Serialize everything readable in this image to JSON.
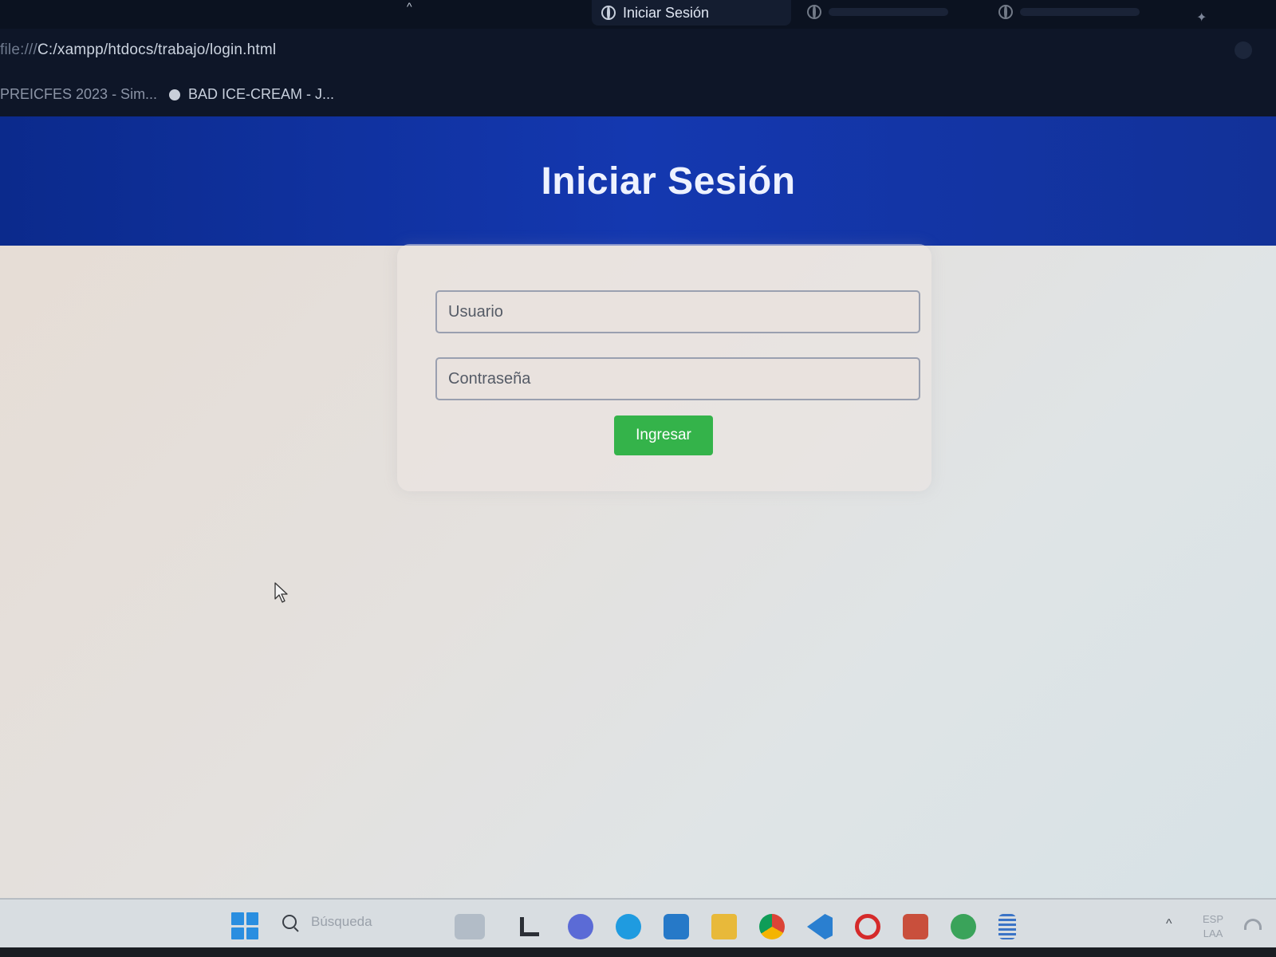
{
  "browser": {
    "active_tab_title": "Iniciar Sesión",
    "url_scheme": "file:///",
    "url_path": "C:/xampp/htdocs/trabajo/login.html",
    "bookmarks": [
      {
        "label": "PREICFES 2023 - Sim..."
      },
      {
        "label": "BAD ICE-CREAM - J..."
      }
    ]
  },
  "page": {
    "title": "Iniciar Sesión",
    "username_placeholder": "Usuario",
    "password_placeholder": "Contraseña",
    "submit_label": "Ingresar"
  },
  "taskbar": {
    "search_placeholder": "Búsqueda",
    "language_line1": "ESP",
    "language_line2": "LAA"
  },
  "colors": {
    "header_blue": "#1438b0",
    "button_green": "#34b34a"
  }
}
